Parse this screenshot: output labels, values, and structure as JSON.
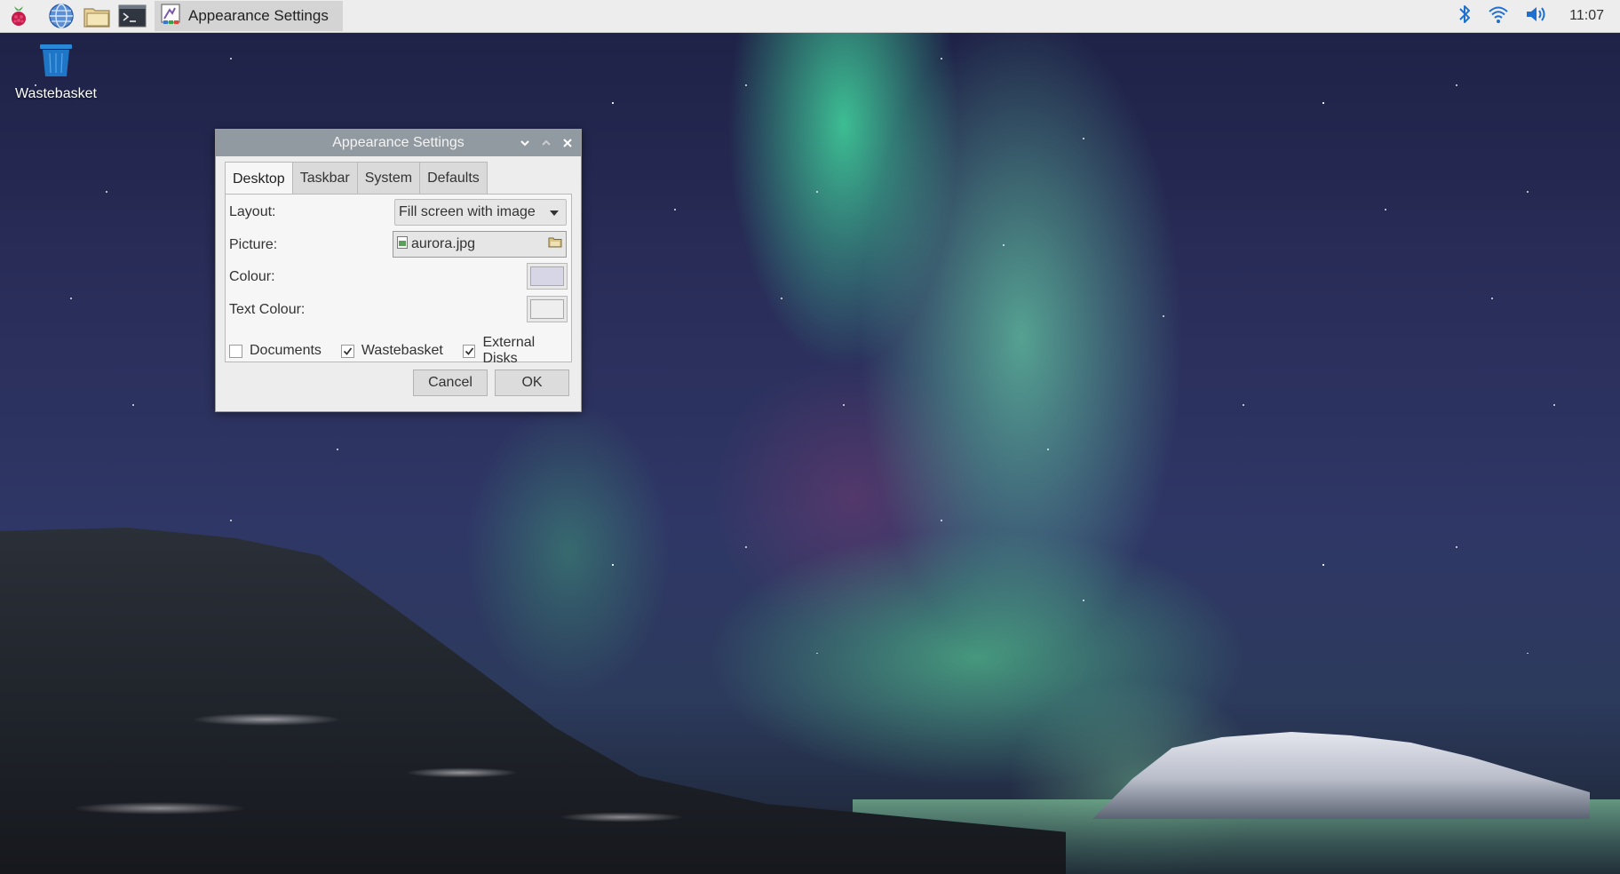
{
  "taskbar": {
    "launchers": [
      {
        "icon": "raspberry-menu-icon"
      },
      {
        "icon": "web-browser-icon"
      },
      {
        "icon": "file-manager-icon"
      },
      {
        "icon": "terminal-icon"
      }
    ],
    "window_button": {
      "icon": "appearance-settings-icon",
      "label": "Appearance Settings"
    },
    "tray": {
      "bluetooth": "bluetooth-icon",
      "wifi": "wifi-icon",
      "volume": "volume-icon"
    },
    "clock": "11:07"
  },
  "desktop": {
    "icons": [
      {
        "icon": "wastebasket-icon",
        "label": "Wastebasket"
      }
    ]
  },
  "dialog": {
    "title": "Appearance Settings",
    "tabs": [
      {
        "label": "Desktop",
        "active": true
      },
      {
        "label": "Taskbar",
        "active": false
      },
      {
        "label": "System",
        "active": false
      },
      {
        "label": "Defaults",
        "active": false
      }
    ],
    "layout": {
      "label": "Layout:",
      "value": "Fill screen with image"
    },
    "picture": {
      "label": "Picture:",
      "value": "aurora.jpg"
    },
    "colour": {
      "label": "Colour:",
      "value": "#d6d6e6"
    },
    "text_colour": {
      "label": "Text Colour:",
      "value": "#eeeeee"
    },
    "checkboxes": [
      {
        "label": "Documents",
        "checked": false
      },
      {
        "label": "Wastebasket",
        "checked": true
      },
      {
        "label": "External Disks",
        "checked": true
      }
    ],
    "buttons": {
      "cancel": "Cancel",
      "ok": "OK"
    }
  },
  "colors": {
    "taskbar_bg": "#ededed",
    "titlebar_bg": "#929aa1",
    "accent_blue": "#1f6fd1"
  }
}
